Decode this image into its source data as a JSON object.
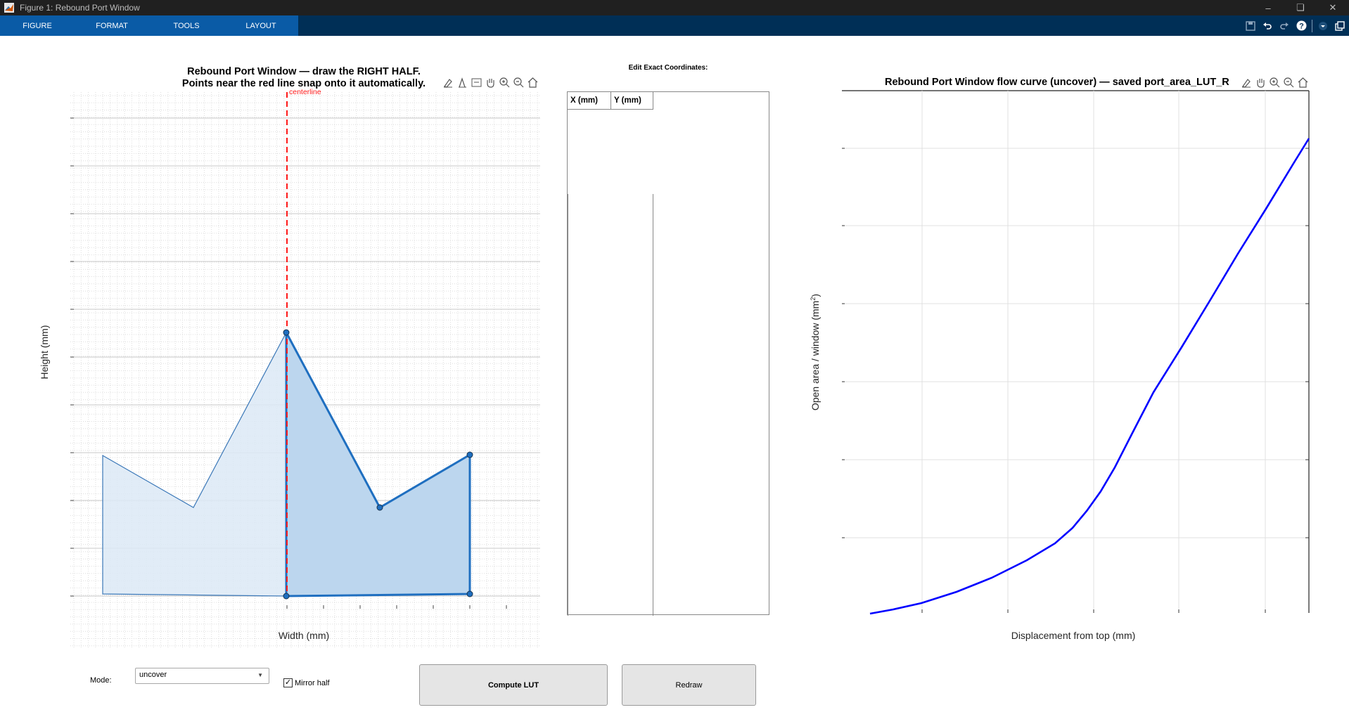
{
  "window": {
    "title": "Figure 1: Rebound Port Window"
  },
  "menu": {
    "tabs": [
      "FIGURE",
      "FORMAT",
      "TOOLS",
      "LAYOUT"
    ]
  },
  "left_plot": {
    "title_line1": "Rebound Port Window — draw the RIGHT HALF.",
    "title_line2": "Points near the red line snap onto it automatically.",
    "xlabel": "Width (mm)",
    "ylabel": "Height (mm)",
    "centerline_label": "centerline"
  },
  "coords_table": {
    "label": "Edit Exact Coordinates:",
    "columns": [
      "X (mm)",
      "Y (mm)"
    ]
  },
  "right_plot": {
    "title": "Rebound Port Window flow curve (uncover) — saved port_area_LUT_R",
    "xlabel": "Displacement from top (mm)",
    "ylabel": "Open area / window (mm",
    "ylabel_sup": "2",
    "ylabel_close": ")"
  },
  "controls": {
    "mode_label": "Mode:",
    "mode_value": "uncover",
    "mirror_label": "Mirror half",
    "mirror_checked": true,
    "compute_label": "Compute LUT",
    "redraw_label": "Redraw"
  },
  "colors": {
    "accent_tab": "#0a5ba6",
    "toolstrip": "#002f56",
    "polygon_line": "#1f6fc0",
    "curve": "#0000ff",
    "centerline": "#ff0000"
  }
}
